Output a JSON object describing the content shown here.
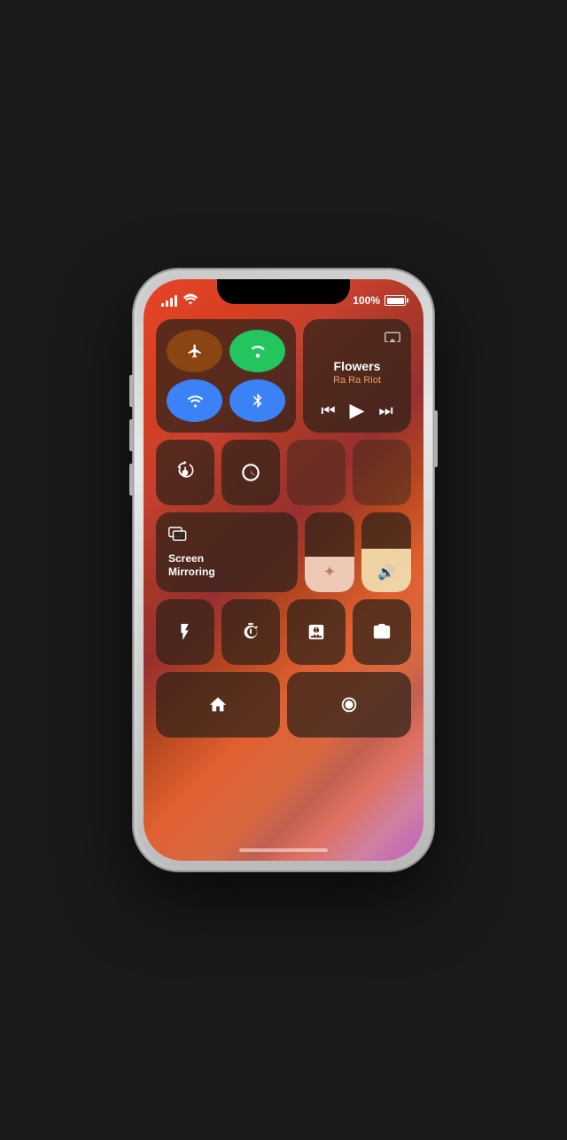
{
  "status_bar": {
    "battery_percent": "100%",
    "signal_bars": [
      4,
      7,
      10,
      13,
      16
    ],
    "wifi_label": "wifi"
  },
  "now_playing": {
    "title": "Flowers",
    "artist": "Ra Ra Riot",
    "airplay_label": "airplay"
  },
  "screen_mirroring": {
    "label_line1": "Screen",
    "label_line2": "Mirroring",
    "full_label": "Screen Mirroring"
  },
  "controls": {
    "airplane_mode": "airplane-mode",
    "cellular": "cellular",
    "wifi": "wifi",
    "bluetooth": "bluetooth",
    "rotation_lock": "rotation-lock",
    "do_not_disturb": "do-not-disturb",
    "flashlight": "flashlight",
    "timer": "timer",
    "calculator": "calculator",
    "camera": "camera",
    "home": "home-kit",
    "screen_record": "screen-record"
  },
  "sliders": {
    "brightness_value": 45,
    "volume_value": 55
  }
}
